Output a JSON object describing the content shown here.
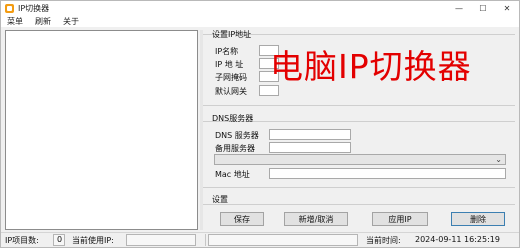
{
  "window": {
    "title": "IP切换器"
  },
  "menu": {
    "items": [
      "菜单",
      "刷新",
      "关于"
    ]
  },
  "ip_group": {
    "title": "设置IP地址",
    "labels": {
      "name": "IP名称",
      "ip": "IP 地 址",
      "mask": "子网掩码",
      "gateway": "默认网关"
    }
  },
  "dns_group": {
    "title": "DNS服务器",
    "labels": {
      "primary": "DNS 服务器",
      "backup": "备用服务器",
      "mac": "Mac 地址"
    }
  },
  "settings_group": {
    "title": "设置",
    "buttons": {
      "save": "保存",
      "add_cancel": "新增/取消",
      "apply": "应用IP",
      "delete": "删除"
    }
  },
  "status": {
    "count_label": "IP项目数:",
    "count_value": "0",
    "current_label": "当前使用IP:",
    "time_label": "当前时间:",
    "time_value": "2024-09-11 16:25:19"
  },
  "overlay_text": "电脑IP切换器"
}
